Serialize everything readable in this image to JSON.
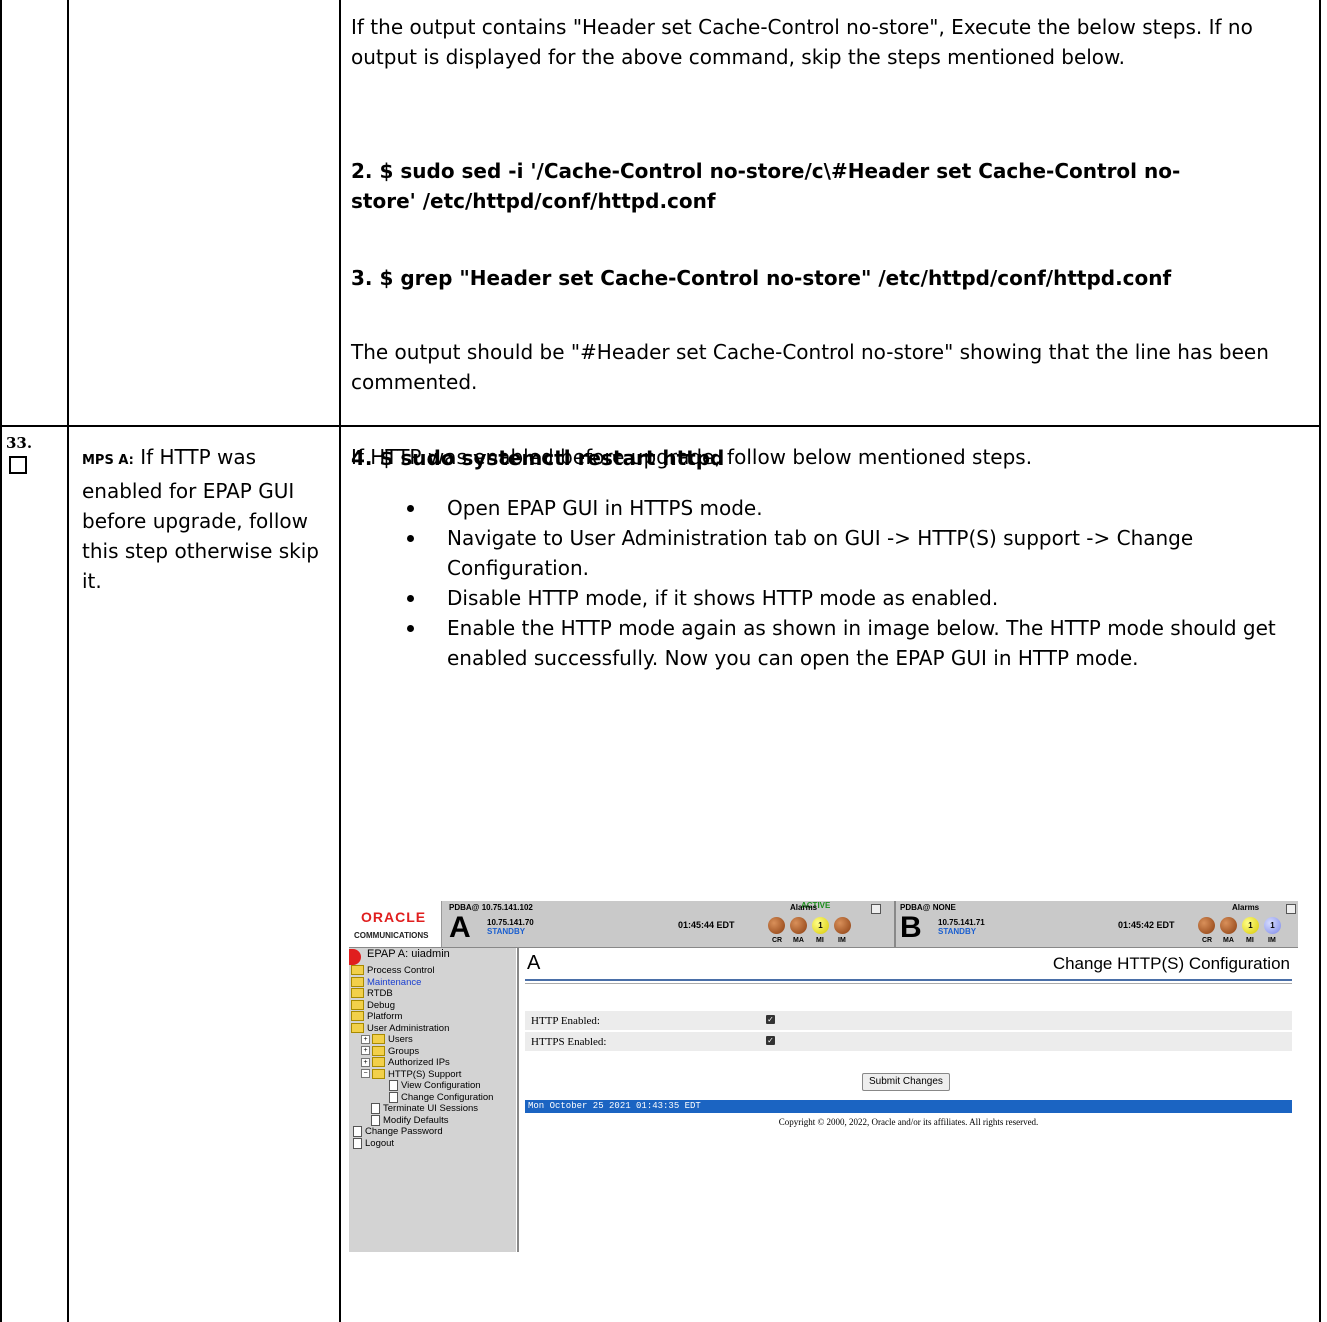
{
  "top_block": {
    "intro": "If the output contains \"Header set Cache-Control no-store\", Execute the below steps. If no output is displayed for the above command, skip the steps mentioned below.",
    "step2_line1": "2. $ sudo sed -i '/Cache-Control no-store/c\\#Header set Cache-Control no-",
    "step2_line2": "store' /etc/httpd/conf/httpd.conf",
    "step3": "3. $ grep \"Header set Cache-Control no-store\" /etc/httpd/conf/httpd.conf",
    "note": "The output should be \"#Header set Cache-Control no-store\" showing that the line has been commented.",
    "step4": "4. $ sudo systemctl restart httpd"
  },
  "step": {
    "number": "33.",
    "label": "MPS A:",
    "description": " If HTTP was enabled for EPAP GUI before upgrade, follow this step otherwise skip it.",
    "intro": "If HTTP was enabled before upgrade, follow below mentioned steps.",
    "bullets": [
      "Open EPAP GUI in HTTPS mode.",
      "Navigate to User Administration tab on GUI -> HTTP(S) support -> Change Configuration.",
      "Disable HTTP mode, if it shows HTTP mode as enabled.",
      "Enable the HTTP mode again as shown in image below. The HTTP mode should get enabled successfully. Now you can open the EPAP GUI in HTTP mode."
    ]
  },
  "gui": {
    "logo_top": "ORACLE",
    "logo_bottom": "COMMUNICATIONS",
    "a": {
      "pdba": "PDBA@ 10.75.141.102",
      "letter": "A",
      "ip": "10.75.141.70",
      "state": "STANDBY",
      "active": "ACTIVE",
      "time": "01:45:44 EDT",
      "alarms": "Alarms",
      "mi_count": "1"
    },
    "b": {
      "pdba": "PDBA@ NONE",
      "letter": "B",
      "ip": "10.75.141.71",
      "state": "STANDBY",
      "time": "01:45:42 EDT",
      "alarms": "Alarms",
      "mi_count": "1",
      "im_count": "1"
    },
    "alarm_labels": [
      "CR",
      "MA",
      "MI",
      "IM"
    ],
    "user": "EPAP A: uiadmin",
    "menu": {
      "process_control": "Process Control",
      "maintenance": "Maintenance",
      "rtdb": "RTDB",
      "debug": "Debug",
      "platform": "Platform",
      "user_admin": "User Administration",
      "users": "Users",
      "groups": "Groups",
      "authorized_ips": "Authorized IPs",
      "https_support": "HTTP(S) Support",
      "view_config": "View Configuration",
      "change_config": "Change Configuration",
      "terminate_sessions": "Terminate UI Sessions",
      "modify_defaults": "Modify Defaults",
      "change_password": "Change Password",
      "logout": "Logout"
    },
    "content": {
      "letter": "A",
      "title": "Change HTTP(S) Configuration",
      "http_label": "HTTP Enabled:",
      "https_label": "HTTPS Enabled:",
      "submit": "Submit Changes",
      "status": "Mon October 25 2021 01:43:35 EDT",
      "copyright": "Copyright © 2000, 2022, Oracle and/or its affiliates. All rights reserved."
    }
  }
}
